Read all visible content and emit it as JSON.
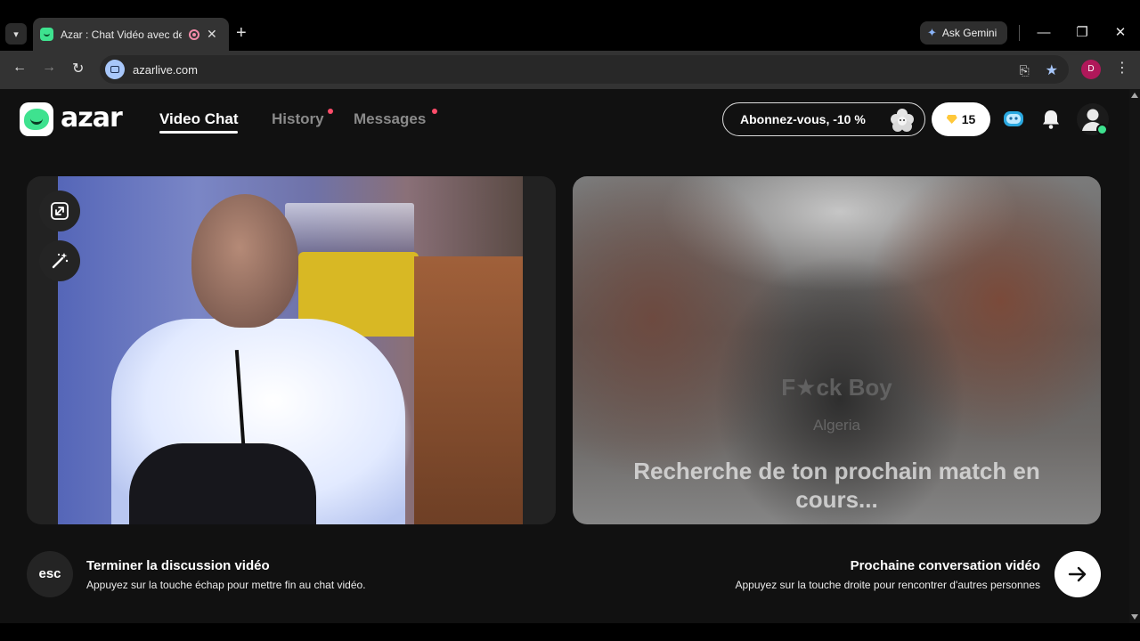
{
  "browser": {
    "tab_title": "Azar : Chat Vidéo avec de n",
    "tab_close": "✕",
    "new_tab": "+",
    "gemini_label": "Ask Gemini",
    "url": "azarlive.com",
    "profile_initial": "D",
    "window_minimize": "—",
    "window_restore": "❐",
    "window_close": "✕"
  },
  "header": {
    "brand": "azar",
    "nav": [
      {
        "label": "Video Chat",
        "active": true
      },
      {
        "label": "History",
        "active": false,
        "dot": true
      },
      {
        "label": "Messages",
        "active": false,
        "dot": true
      }
    ],
    "promo_label": "Abonnez-vous, -10 %",
    "gems_count": "15"
  },
  "remote": {
    "name": "F★ck Boy",
    "country": "Algeria",
    "status": "Recherche de ton prochain match en cours..."
  },
  "controls": {
    "esc_key": "esc",
    "end_title": "Terminer la discussion vidéo",
    "end_subtitle": "Appuyez sur la touche échap pour mettre fin au chat vidéo.",
    "next_title": "Prochaine conversation vidéo",
    "next_subtitle": "Appuyez sur la touche droite pour rencontrer d'autres personnes"
  },
  "colors": {
    "brand_green": "#3ee28f",
    "notification_dot": "#ff4d6a",
    "gem_gold": "#ffc83a",
    "page_bg": "#111111"
  }
}
